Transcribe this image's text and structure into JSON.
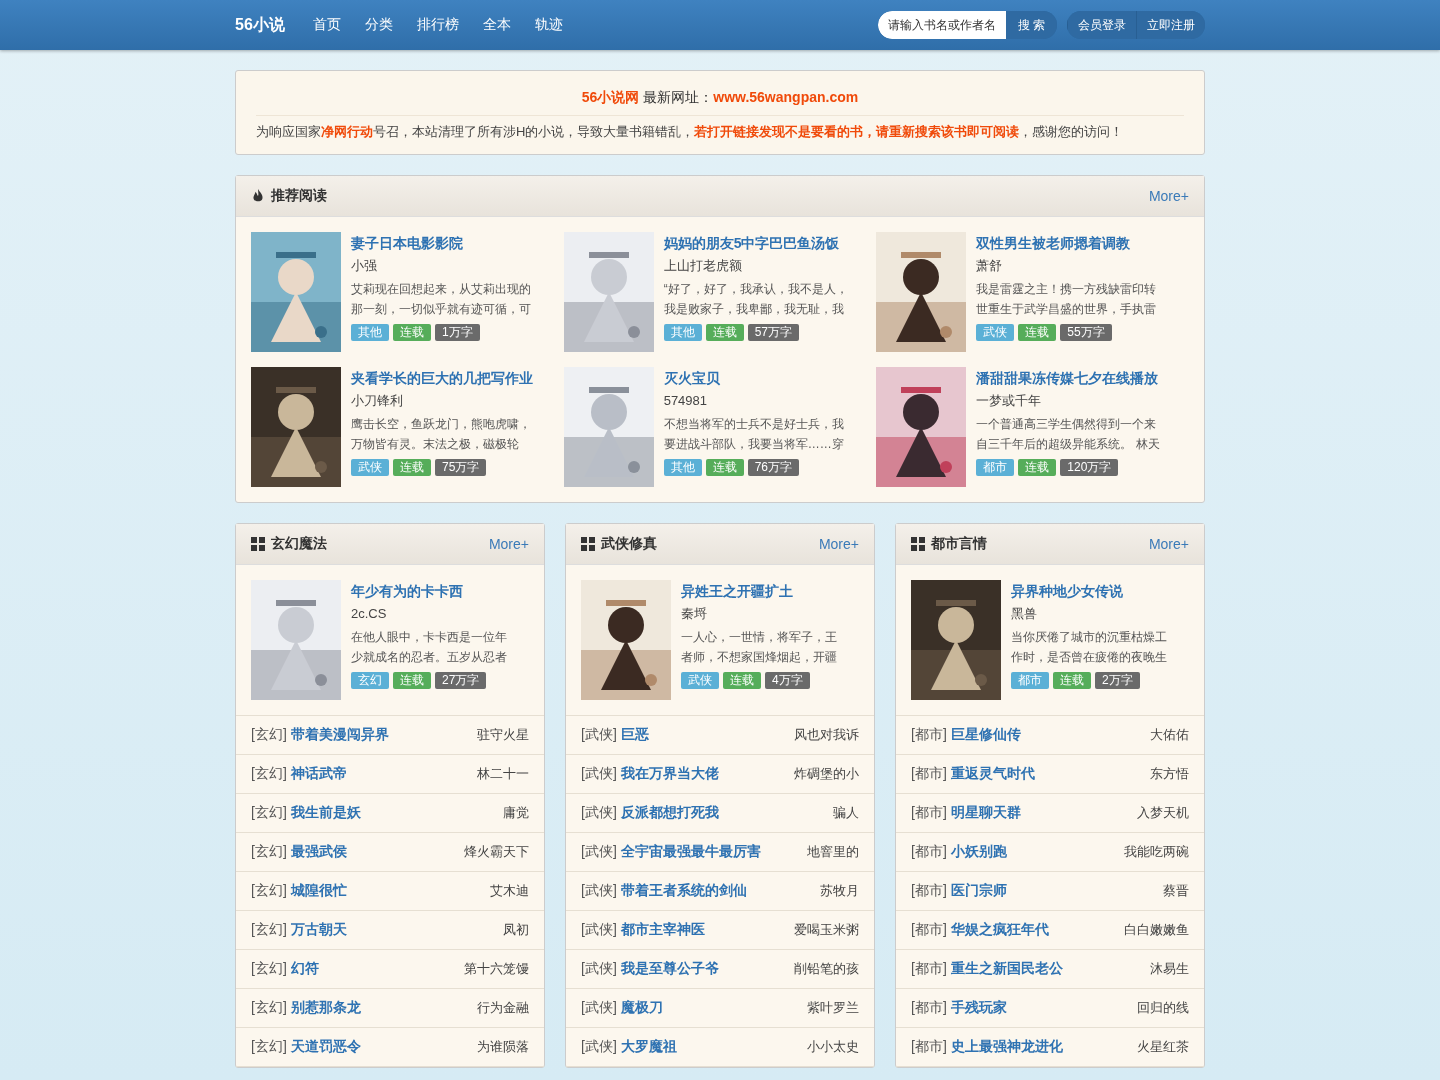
{
  "navbar": {
    "logo": "56小说",
    "links": [
      {
        "label": "首页"
      },
      {
        "label": "分类"
      },
      {
        "label": "排行榜"
      },
      {
        "label": "全本"
      },
      {
        "label": "轨迹"
      }
    ],
    "search": {
      "placeholder": "请输入书名或作者名",
      "button": "搜 索"
    },
    "account": [
      "会员登录",
      "立即注册"
    ]
  },
  "notice": {
    "headline": "**56小说网** 最新网址：**www.56wangpan.com**",
    "body": "为响应国家**净网行动**号召，本站清理了所有涉H的小说，导致大量书籍错乱，**若打开链接发现不是要看的书，请重新搜索该书即可阅读**，感谢您的访问！"
  },
  "recommend": {
    "title": "推荐阅读",
    "more": "More+",
    "books": [
      {
        "title": "妻子日本电影影院",
        "author": "小强",
        "desc_lines": [
          "艾莉现在回想起来，从艾莉出现的",
          "那一刻，一切似乎就有迹可循，可"
        ],
        "tags": [
          {
            "kind": "category",
            "label": "其他"
          },
          {
            "kind": "status",
            "label": "连载"
          },
          {
            "kind": "size",
            "label": "1万字"
          }
        ]
      },
      {
        "title": "妈妈的朋友5中字巴巴鱼汤饭",
        "author": "上山打老虎额",
        "desc_lines": [
          "“好了，好了，我承认，我不是人，",
          "我是败家子，我卑鄙，我无耻，我"
        ],
        "tags": [
          {
            "kind": "category",
            "label": "其他"
          },
          {
            "kind": "status",
            "label": "连载"
          },
          {
            "kind": "size",
            "label": "57万字"
          }
        ]
      },
      {
        "title": "双性男生被老师摁着调教",
        "author": "萧舒",
        "desc_lines": [
          "我是雷霆之主！携一方残缺雷印转",
          "世重生于武学昌盛的世界，手执雷"
        ],
        "tags": [
          {
            "kind": "category",
            "label": "武侠"
          },
          {
            "kind": "status",
            "label": "连载"
          },
          {
            "kind": "size",
            "label": "55万字"
          }
        ]
      },
      {
        "title": "夹看学长的巨大的几把写作业",
        "author": "小刀锋利",
        "desc_lines": [
          "鹰击长空，鱼跃龙门，熊咆虎啸，",
          "万物皆有灵。末法之极，磁极轮"
        ],
        "tags": [
          {
            "kind": "category",
            "label": "武侠"
          },
          {
            "kind": "status",
            "label": "连载"
          },
          {
            "kind": "size",
            "label": "75万字"
          }
        ]
      },
      {
        "title": "灭火宝贝",
        "author": "574981",
        "desc_lines": [
          "不想当将军的士兵不是好士兵，我",
          "要进战斗部队，我要当将军……穿"
        ],
        "tags": [
          {
            "kind": "category",
            "label": "其他"
          },
          {
            "kind": "status",
            "label": "连载"
          },
          {
            "kind": "size",
            "label": "76万字"
          }
        ]
      },
      {
        "title": "潘甜甜果冻传媒七夕在线播放",
        "author": "一梦或千年",
        "desc_lines": [
          "一个普通高三学生偶然得到一个来",
          "自三千年后的超级异能系统。 林天"
        ],
        "tags": [
          {
            "kind": "category",
            "label": "都市"
          },
          {
            "kind": "status",
            "label": "连载"
          },
          {
            "kind": "size",
            "label": "120万字"
          }
        ]
      }
    ]
  },
  "categories": [
    {
      "title": "玄幻魔法",
      "more": "More+",
      "featured": {
        "title": "年少有为的卡卡西",
        "author": "2c.CS",
        "desc_lines": [
          "在他人眼中，卡卡西是一位年",
          "少就成名的忍者。五岁从忍者"
        ],
        "tags": [
          {
            "kind": "category",
            "label": "玄幻"
          },
          {
            "kind": "status",
            "label": "连载"
          },
          {
            "kind": "size",
            "label": "27万字"
          }
        ]
      },
      "list": [
        {
          "genre": "[玄幻]",
          "title": "带着美漫闯异界",
          "author": "驻守火星"
        },
        {
          "genre": "[玄幻]",
          "title": "神话武帝",
          "author": "林二十一"
        },
        {
          "genre": "[玄幻]",
          "title": "我生前是妖",
          "author": "庸觉"
        },
        {
          "genre": "[玄幻]",
          "title": "最强武侯",
          "author": "烽火霸天下"
        },
        {
          "genre": "[玄幻]",
          "title": "城隍很忙",
          "author": "艾木迪"
        },
        {
          "genre": "[玄幻]",
          "title": "万古朝天",
          "author": "凤初"
        },
        {
          "genre": "[玄幻]",
          "title": "幻符",
          "author": "第十六笼馒"
        },
        {
          "genre": "[玄幻]",
          "title": "别惹那条龙",
          "author": "行为金融"
        },
        {
          "genre": "[玄幻]",
          "title": "天道罚恶令",
          "author": "为谁陨落"
        }
      ]
    },
    {
      "title": "武侠修真",
      "more": "More+",
      "featured": {
        "title": "异姓王之开疆扩土",
        "author": "秦埒",
        "desc_lines": [
          "一人心，一世情，将军子，王",
          "者师，不想家国烽烟起，开疆"
        ],
        "tags": [
          {
            "kind": "category",
            "label": "武侠"
          },
          {
            "kind": "status",
            "label": "连载"
          },
          {
            "kind": "size",
            "label": "4万字"
          }
        ]
      },
      "list": [
        {
          "genre": "[武侠]",
          "title": "巨恶",
          "author": "风也对我诉"
        },
        {
          "genre": "[武侠]",
          "title": "我在万界当大佬",
          "author": "炸碉堡的小"
        },
        {
          "genre": "[武侠]",
          "title": "反派都想打死我",
          "author": "骗人"
        },
        {
          "genre": "[武侠]",
          "title": "全宇宙最强最牛最厉害",
          "author": "地窨里的"
        },
        {
          "genre": "[武侠]",
          "title": "带着王者系统的剑仙",
          "author": "苏牧月"
        },
        {
          "genre": "[武侠]",
          "title": "都市主宰神医",
          "author": "爱喝玉米粥"
        },
        {
          "genre": "[武侠]",
          "title": "我是至尊公子爷",
          "author": "削铅笔的孩"
        },
        {
          "genre": "[武侠]",
          "title": "魔极刀",
          "author": "紫叶罗兰"
        },
        {
          "genre": "[武侠]",
          "title": "大罗魔祖",
          "author": "小小太史"
        }
      ]
    },
    {
      "title": "都市言情",
      "more": "More+",
      "featured": {
        "title": "异界种地少女传说",
        "author": "黑兽",
        "desc_lines": [
          "当你厌倦了城市的沉重枯燥工",
          "作时，是否曾在疲倦的夜晚生"
        ],
        "tags": [
          {
            "kind": "category",
            "label": "都市"
          },
          {
            "kind": "status",
            "label": "连载"
          },
          {
            "kind": "size",
            "label": "2万字"
          }
        ]
      },
      "list": [
        {
          "genre": "[都市]",
          "title": "巨星修仙传",
          "author": "大佑佑"
        },
        {
          "genre": "[都市]",
          "title": "重返灵气时代",
          "author": "东方悟"
        },
        {
          "genre": "[都市]",
          "title": "明星聊天群",
          "author": "入梦天机"
        },
        {
          "genre": "[都市]",
          "title": "小妖别跑",
          "author": "我能吃两碗"
        },
        {
          "genre": "[都市]",
          "title": "医门宗师",
          "author": "蔡晋"
        },
        {
          "genre": "[都市]",
          "title": "华娱之疯狂年代",
          "author": "白白嫩嫩鱼"
        },
        {
          "genre": "[都市]",
          "title": "重生之新国民老公",
          "author": "沐易生"
        },
        {
          "genre": "[都市]",
          "title": "手残玩家",
          "author": "回归的线"
        },
        {
          "genre": "[都市]",
          "title": "史上最强神龙进化",
          "author": "火星红茶"
        }
      ]
    }
  ]
}
